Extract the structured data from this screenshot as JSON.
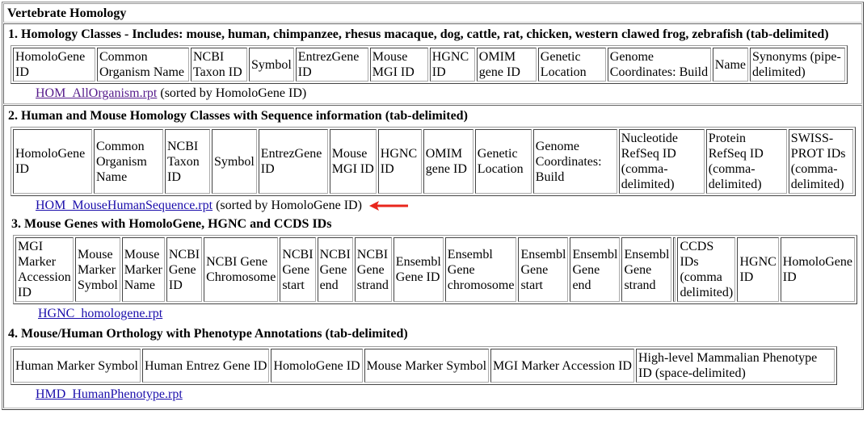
{
  "page_title": "Vertebrate Homology",
  "colors": {
    "link": "#1a0dab",
    "visited_link": "#551a8b",
    "arrow": "#e8261c"
  },
  "sections": [
    {
      "title": "1. Homology Classes - Includes: mouse, human, chimpanzee, rhesus macaque, dog, cattle, rat, chicken, western clawed frog, zebrafish (tab-delimited)",
      "columns": [
        "HomoloGene ID",
        "Common Organism Name",
        "NCBI Taxon ID",
        "Symbol",
        "EntrezGene ID",
        "Mouse MGI ID",
        "HGNC ID",
        "OMIM gene ID",
        "Genetic Location",
        "Genome Coordinates: Build",
        "Name",
        "Synonyms (pipe-delimited)"
      ],
      "file_link": "HOM_AllOrganism.rpt",
      "note": "(sorted by HomoloGene ID)"
    },
    {
      "title": "2. Human and Mouse Homology Classes with Sequence information (tab-delimited)",
      "columns": [
        "HomoloGene ID",
        "Common Organism Name",
        "NCBI Taxon ID",
        "Symbol",
        "EntrezGene ID",
        "Mouse MGI ID",
        "HGNC ID",
        "OMIM gene ID",
        "Genetic Location",
        "Genome Coordinates: Build",
        "Nucleotide RefSeq ID (comma-delimited)",
        "Protein RefSeq ID (comma-delimited)",
        "SWISS-PROT IDs (comma-delimited)"
      ],
      "file_link": "HOM_MouseHumanSequence.rpt",
      "note": "(sorted by HomoloGene ID)",
      "annotation_arrow": "arrow-left"
    },
    {
      "title": "3. Mouse Genes with HomoloGene, HGNC and CCDS IDs",
      "columns": [
        "MGI Marker Accession ID",
        "Mouse Marker Symbol",
        "Mouse Marker Name",
        "NCBI Gene ID",
        "NCBI Gene Chromosome",
        "NCBI Gene start",
        "NCBI Gene end",
        "NCBI Gene strand",
        "Ensembl Gene ID",
        "Ensembl Gene chromosome",
        "Ensembl Gene start",
        "Ensembl Gene end",
        "Ensembl Gene strand",
        "",
        "CCDS IDs (comma delimited)",
        "HGNC ID",
        "HomoloGene ID"
      ],
      "file_link": "HGNC_homologene.rpt",
      "note": ""
    },
    {
      "title": "4. Mouse/Human Orthology with Phenotype Annotations (tab-delimited)",
      "columns": [
        "Human Marker Symbol",
        "Human Entrez Gene ID",
        "HomoloGene ID",
        "Mouse Marker Symbol",
        "MGI Marker Accession ID",
        "High-level Mammalian Phenotype ID (space-delimited)"
      ],
      "file_link": "HMD_HumanPhenotype.rpt",
      "note": ""
    }
  ]
}
